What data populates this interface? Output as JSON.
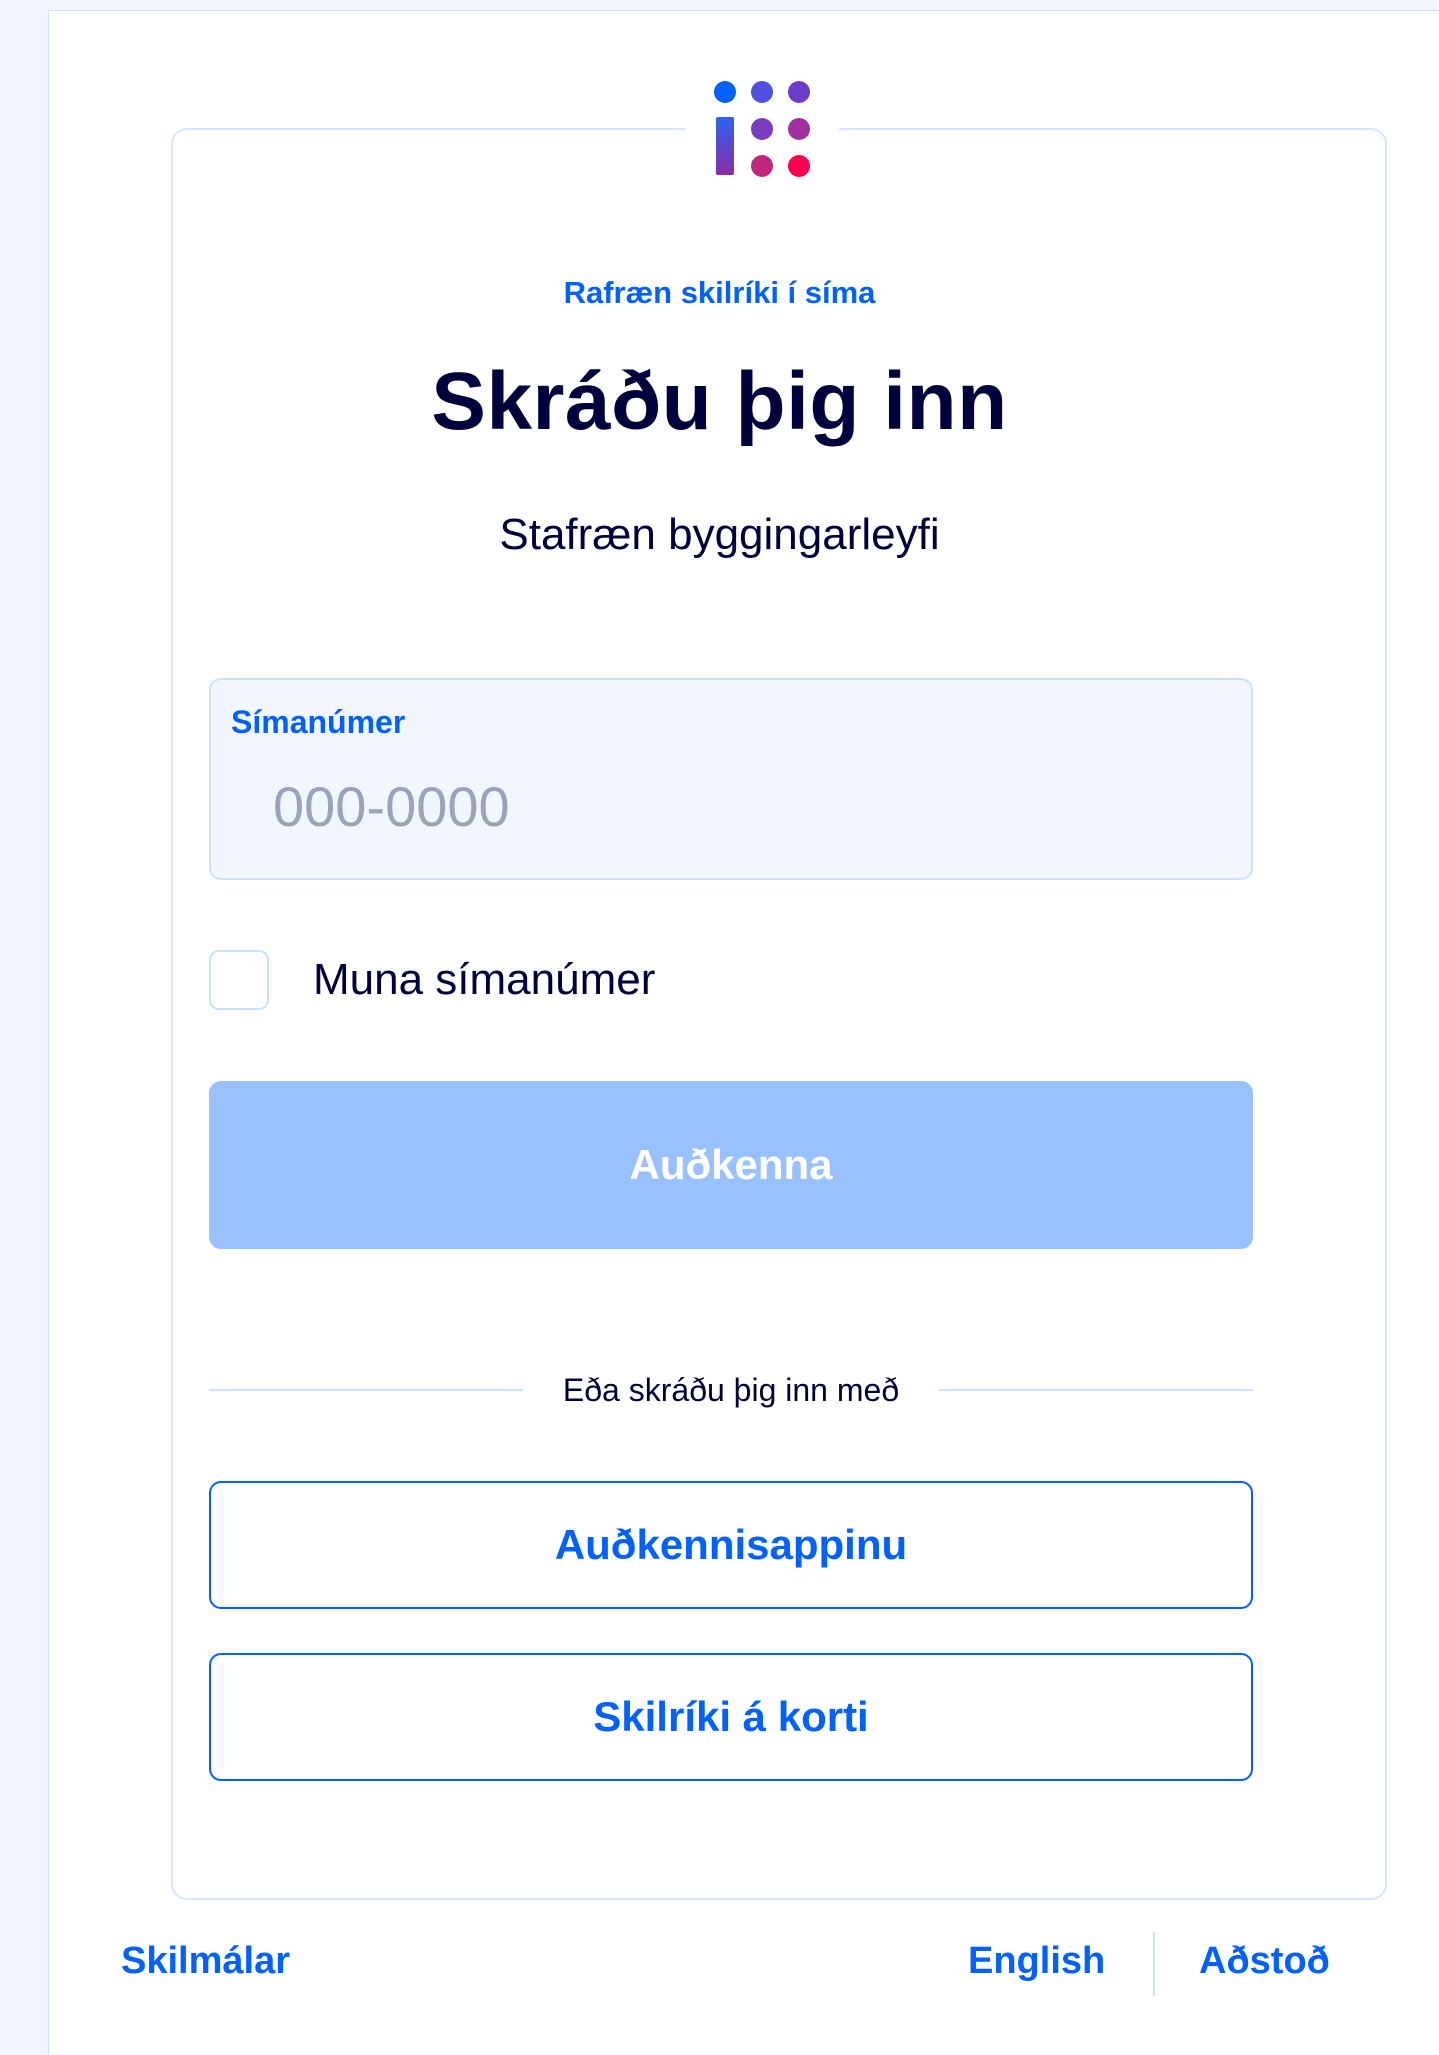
{
  "header": {
    "logo_icon": "island-dots-logo",
    "colors": {
      "blue": "#0061ff",
      "purple": "#6a3cc7",
      "pink": "#c0287e",
      "red": "#ff0050"
    }
  },
  "login": {
    "auth_method": "Rafræn skilríki í síma",
    "title": "Skráðu þig inn",
    "service_name": "Stafræn byggingarleyfi",
    "phone": {
      "label": "Símanúmer",
      "value": "",
      "placeholder": "000-0000"
    },
    "remember": {
      "label": "Muna símanúmer",
      "checked": false
    },
    "submit_label": "Auðkenna",
    "divider_text": "Eða skráðu þig inn með",
    "alternatives": {
      "app_label": "Auðkennisappinu",
      "card_label": "Skilríki á korti"
    }
  },
  "footer": {
    "terms": "Skilmálar",
    "language": "English",
    "help": "Aðstoð"
  }
}
